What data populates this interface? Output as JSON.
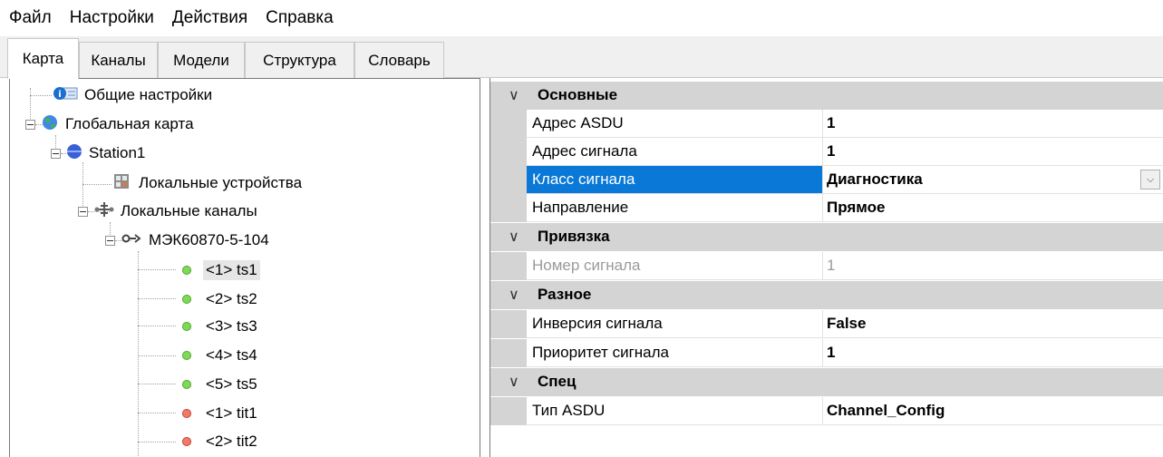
{
  "menu": [
    "Файл",
    "Настройки",
    "Действия",
    "Справка"
  ],
  "tabs": [
    "Карта",
    "Каналы",
    "Модели",
    "Структура",
    "Словарь"
  ],
  "active_tab": "Карта",
  "tree": {
    "general_settings": "Общие настройки",
    "global_map": "Глобальная карта",
    "station": "Station1",
    "local_devices": "Локальные устройства",
    "local_channels": "Локальные каналы",
    "protocol": "МЭК60870-5-104",
    "signals": [
      {
        "label": "<1> ts1",
        "status": "green"
      },
      {
        "label": "<2> ts2",
        "status": "green"
      },
      {
        "label": "<3> ts3",
        "status": "green"
      },
      {
        "label": "<4> ts4",
        "status": "green"
      },
      {
        "label": "<5> ts5",
        "status": "green"
      },
      {
        "label": "<1> tit1",
        "status": "red"
      },
      {
        "label": "<2> tit2",
        "status": "red"
      }
    ],
    "selected": "<1> ts1"
  },
  "properties": {
    "cat_main": "Основные",
    "asdu_address_name": "Адрес ASDU",
    "asdu_address_value": "1",
    "signal_address_name": "Адрес сигнала",
    "signal_address_value": "1",
    "signal_class_name": "Класс сигнала",
    "signal_class_value": "Диагностика",
    "direction_name": "Направление",
    "direction_value": "Прямое",
    "cat_binding": "Привязка",
    "signal_number_name": "Номер сигнала",
    "signal_number_value": "1",
    "cat_misc": "Разное",
    "inversion_name": "Инверсия сигнала",
    "inversion_value": "False",
    "priority_name": "Приоритет сигнала",
    "priority_value": "1",
    "cat_spec": "Спец",
    "asdu_type_name": "Тип ASDU",
    "asdu_type_value": "Channel_Config"
  },
  "colors": {
    "selection": "#0a78d7",
    "category_bg": "#d4d4d4",
    "status_ok": "#7ed957",
    "status_error": "#f07a6a"
  }
}
